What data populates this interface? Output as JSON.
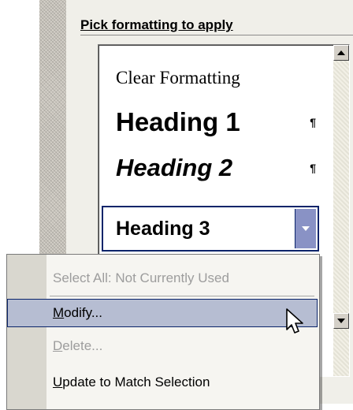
{
  "task_pane": {
    "section_title": "Pick formatting to apply",
    "styles": [
      {
        "label": "Clear Formatting",
        "mark": ""
      },
      {
        "label": "Heading 1",
        "mark": "¶"
      },
      {
        "label": "Heading 2",
        "mark": "¶"
      },
      {
        "label": "Heading 3",
        "mark": "",
        "selected": true
      }
    ]
  },
  "context_menu": {
    "items": [
      {
        "label": "Select All: Not Currently Used",
        "state": "disabled"
      },
      {
        "label": "Modify...",
        "accel": "M",
        "state": "hover"
      },
      {
        "label": "Delete...",
        "accel": "D",
        "state": "disabled"
      },
      {
        "label": "Update to Match Selection",
        "accel": "U",
        "state": "enabled"
      }
    ]
  },
  "colors": {
    "selection_border": "#0a246a",
    "menu_highlight": "#b6bdd2",
    "dropdown_button": "#8992c5"
  }
}
